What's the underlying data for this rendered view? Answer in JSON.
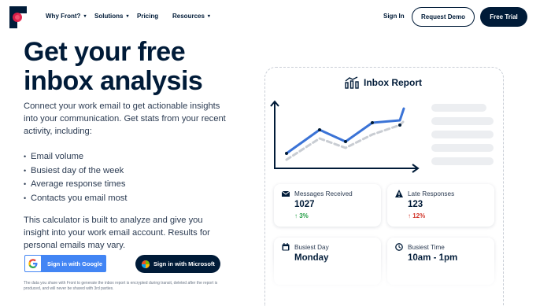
{
  "header": {
    "nav": [
      {
        "label": "Why Front?",
        "dropdown": true
      },
      {
        "label": "Solutions",
        "dropdown": true
      },
      {
        "label": "Pricing",
        "dropdown": false
      },
      {
        "label": "Resources",
        "dropdown": true
      }
    ],
    "signin_label": "Sign In",
    "demo_label": "Request Demo",
    "trial_label": "Free Trial"
  },
  "hero": {
    "title_line1": "Get your free",
    "title_line2": "inbox analysis",
    "intro": "Connect your work email to get actionable insights into your communication. Get stats from your recent activity, including:",
    "bullets": [
      "Email volume",
      "Busiest day of the week",
      "Average response times",
      "Contacts you email most"
    ],
    "note": "This calculator is built to analyze and give you insight into your work email account. Results for personal emails may vary.",
    "google_button": "Sign in with Google",
    "microsoft_button": "Sign in with Microsoft",
    "disclaimer": "The data you share with Front to generate the inbox report is encrypted during transit, deleted after the report is produced, and will never be shared with 3rd parties."
  },
  "report": {
    "title": "Inbox Report",
    "stats": [
      {
        "label": "Messages Received",
        "value": "1027",
        "change": "3%",
        "direction": "up",
        "icon": "inbox-icon"
      },
      {
        "label": "Late Responses",
        "value": "123",
        "change": "12%",
        "direction": "down",
        "icon": "warning-icon"
      },
      {
        "label": "Busiest Day",
        "value": "Monday",
        "icon": "calendar-icon"
      },
      {
        "label": "Busiest Time",
        "value": "10am - 1pm",
        "icon": "clock-icon"
      }
    ]
  },
  "colors": {
    "navy": "#001B38",
    "brand_red": "#E21D48",
    "chart_blue": "#3B73D6",
    "up_green": "#2aa14a",
    "down_red": "#d2382d",
    "google_blue": "#4285F4"
  }
}
